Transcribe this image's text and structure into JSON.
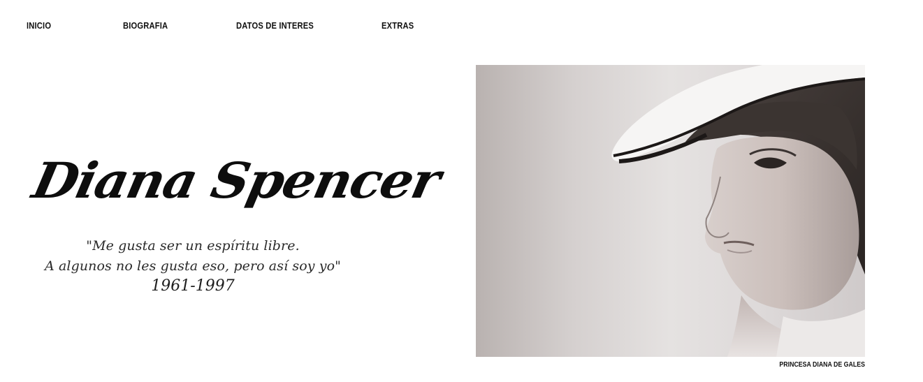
{
  "nav": {
    "items": [
      {
        "label": "INICIO"
      },
      {
        "label": "BIOGRAFIA"
      },
      {
        "label": "DATOS DE INTERES"
      },
      {
        "label": "EXTRAS"
      }
    ]
  },
  "hero": {
    "title": "Diana Spencer",
    "quote_line_1": "\"Me gusta ser un espíritu libre.",
    "quote_line_2": "A algunos no les gusta eso, pero así soy yo\"",
    "years": "1961-1997"
  },
  "photo": {
    "caption": "PRINCESA DIANA DE GALES"
  }
}
